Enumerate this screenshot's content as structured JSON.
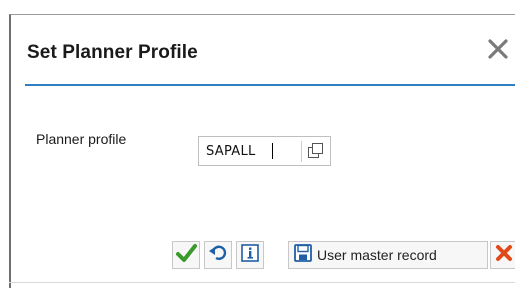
{
  "dialog": {
    "title": "Set Planner Profile",
    "close_icon": "close-icon"
  },
  "form": {
    "planner_profile_label": "Planner profile",
    "planner_profile_value": "SAPALL",
    "value_help_icon": "value-help-icon"
  },
  "toolbar": {
    "continue_icon": "check-icon",
    "undo_icon": "undo-icon",
    "info_icon": "info-icon",
    "save_icon": "save-icon",
    "user_master_record_label": "User master record",
    "cancel_icon": "cancel-icon"
  },
  "colors": {
    "accent": "#2f7fc2",
    "check": "#3a9a2a",
    "cancel": "#e04a1a",
    "icon_blue": "#1f5fa6"
  }
}
